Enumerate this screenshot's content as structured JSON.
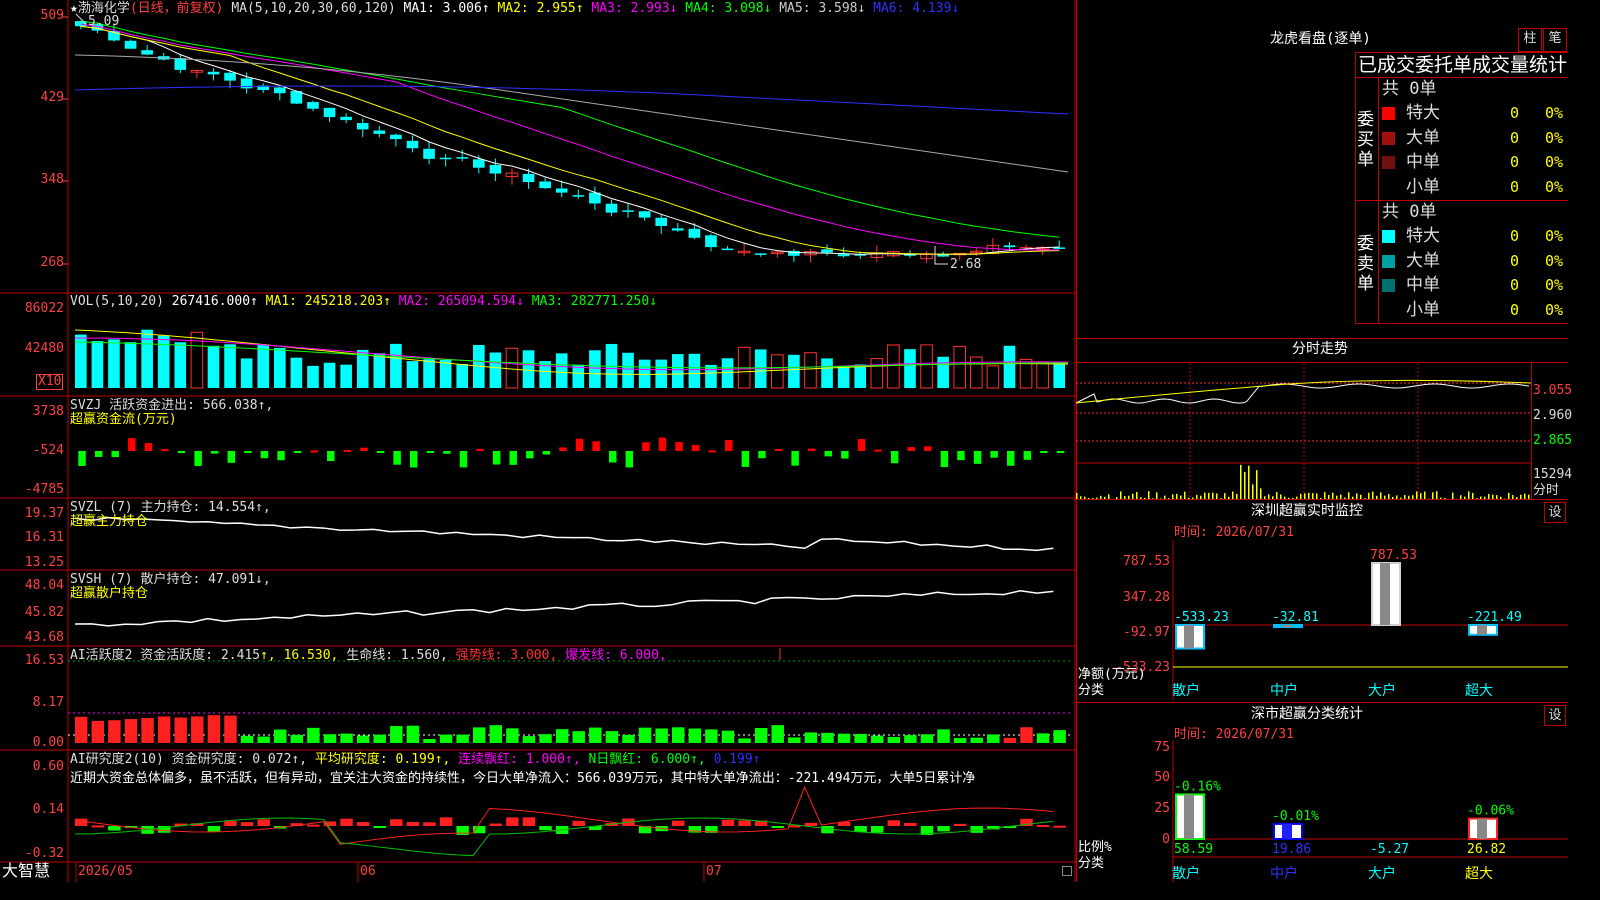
{
  "stock": {
    "star": "★",
    "name": "渤海化学",
    "mode": "(日线，前复权)",
    "ma_label": "MA(5,10,20,30,60,120)",
    "ma1": "MA1: 3.006↑",
    "ma2": "MA2: 2.955↑",
    "ma3": "MA3: 2.993↓",
    "ma4": "MA4: 3.098↓",
    "ma5": "MA5: 3.598↓",
    "ma6": "MA6: 4.139↓",
    "high_mark": "5.09",
    "low_mark": "2.68",
    "axis": [
      "509",
      "429",
      "348",
      "268"
    ]
  },
  "vol": {
    "label": "VOL(5,10,20)",
    "value": "267416.000↑",
    "ma1": "MA1: 245218.203↑",
    "ma2": "MA2: 265094.594↓",
    "ma3": "MA3: 282771.250↓",
    "axis": [
      "86022",
      "42480"
    ],
    "unit": "X10"
  },
  "svzj": {
    "label": "SVZJ  活跃资金进出: 566.038↑,",
    "sub": "超赢资金流(万元)",
    "axis": [
      "3738",
      "-524",
      "-4785"
    ]
  },
  "svzl": {
    "label": "SVZL (7) 主力持仓: 14.554↑,",
    "sub": "超赢主力持仓",
    "axis": [
      "19.37",
      "16.31",
      "13.25"
    ]
  },
  "svsh": {
    "label": "SVSH (7) 散户持仓: 47.091↓,",
    "sub": "超赢散户持仓",
    "axis": [
      "48.04",
      "45.82",
      "43.68"
    ]
  },
  "ai1": {
    "p1": "AI活跃度2 资金活跃度: 2.415",
    "p2": "↑, 16.530,",
    "p3": "生命线: 1.560,",
    "p4": "强势线: 3.000,",
    "p5": "爆发线: 6.000,",
    "axis": [
      "16.53",
      "8.17",
      "0.00"
    ]
  },
  "ai2": {
    "p1": "AI研究度2(10) 资金研究度: 0.072↑,",
    "p2": "平均研究度: 0.199↑,",
    "p3": "连续飘红: 1.000↑,",
    "p4": "N日飘红: 6.000↑,",
    "p5": "0.199↑",
    "summary": "近期大资金总体偏多，虽不活跃，但有异动，宜关注大资金的持续性，今日大单净流入：566.039万元，其中特大单净流出：-221.494万元，大单5日累计净",
    "axis": [
      "0.60",
      "0.14",
      "-0.32"
    ]
  },
  "bottom": {
    "app_name": "大智慧",
    "months": [
      "2026/05",
      "06",
      "07"
    ]
  },
  "right": {
    "dragon_title": "龙虎看盘(逐单)",
    "btn_bar": "柱",
    "btn_pen": "笔",
    "stats_title": "已成交委托单成交量统计",
    "buy_label": "委买单",
    "sell_label": "委卖单",
    "buy_total": "共 0单",
    "sell_total": "共 0单",
    "buy_rows": [
      {
        "name": "特大",
        "count": "0",
        "pct": "0%",
        "color": "#ff0000"
      },
      {
        "name": "大单",
        "count": "0",
        "pct": "0%",
        "color": "#a01010"
      },
      {
        "name": "中单",
        "count": "0",
        "pct": "0%",
        "color": "#701010"
      },
      {
        "name": "小单",
        "count": "0",
        "pct": "0%",
        "color": "#000000"
      }
    ],
    "sell_rows": [
      {
        "name": "特大",
        "count": "0",
        "pct": "0%",
        "color": "#00ffff"
      },
      {
        "name": "大单",
        "count": "0",
        "pct": "0%",
        "color": "#00a0a0"
      },
      {
        "name": "中单",
        "count": "0",
        "pct": "0%",
        "color": "#007070"
      },
      {
        "name": "小单",
        "count": "0",
        "pct": "0%",
        "color": "#000000"
      }
    ],
    "intraday_title": "分时走势",
    "intraday_axis": [
      "3.055",
      "2.960",
      "2.865"
    ],
    "intraday_vol": "15294",
    "intraday_vol_label": "分时",
    "monitor_title": "深圳超赢实时监控",
    "monitor_btn": "设",
    "monitor_time": "时间: 2026/07/31",
    "monitor_axis": [
      "787.53",
      "347.28",
      "-92.97",
      "-533.23"
    ],
    "monitor_ylabel": "净额(万元)",
    "monitor_xlabel": "分类",
    "monitor_bars": [
      {
        "name": "散户",
        "value": "-533.23",
        "num": -533.23
      },
      {
        "name": "中户",
        "value": "-32.81",
        "num": -32.81
      },
      {
        "name": "大户",
        "value": "787.53",
        "num": 787.53
      },
      {
        "name": "超大",
        "value": "-221.49",
        "num": -221.49
      }
    ],
    "classify_title": "深市超赢分类统计",
    "classify_btn": "设",
    "classify_time": "时间: 2026/07/31",
    "classify_axis": [
      "75",
      "50",
      "25",
      "0"
    ],
    "classify_ylabel": "比例%",
    "classify_xlabel": "分类",
    "classify_bars": [
      {
        "name": "散户",
        "top": "-0.16%",
        "bottom": "58.59",
        "num": 58.59
      },
      {
        "name": "中户",
        "top": "-0.01%",
        "bottom": "19.86",
        "num": 19.86
      },
      {
        "name": "大户",
        "top": "",
        "bottom": "-5.27",
        "num": 0
      },
      {
        "name": "超大",
        "top": "-0.06%",
        "bottom": "26.82",
        "num": 26.82
      }
    ]
  }
}
